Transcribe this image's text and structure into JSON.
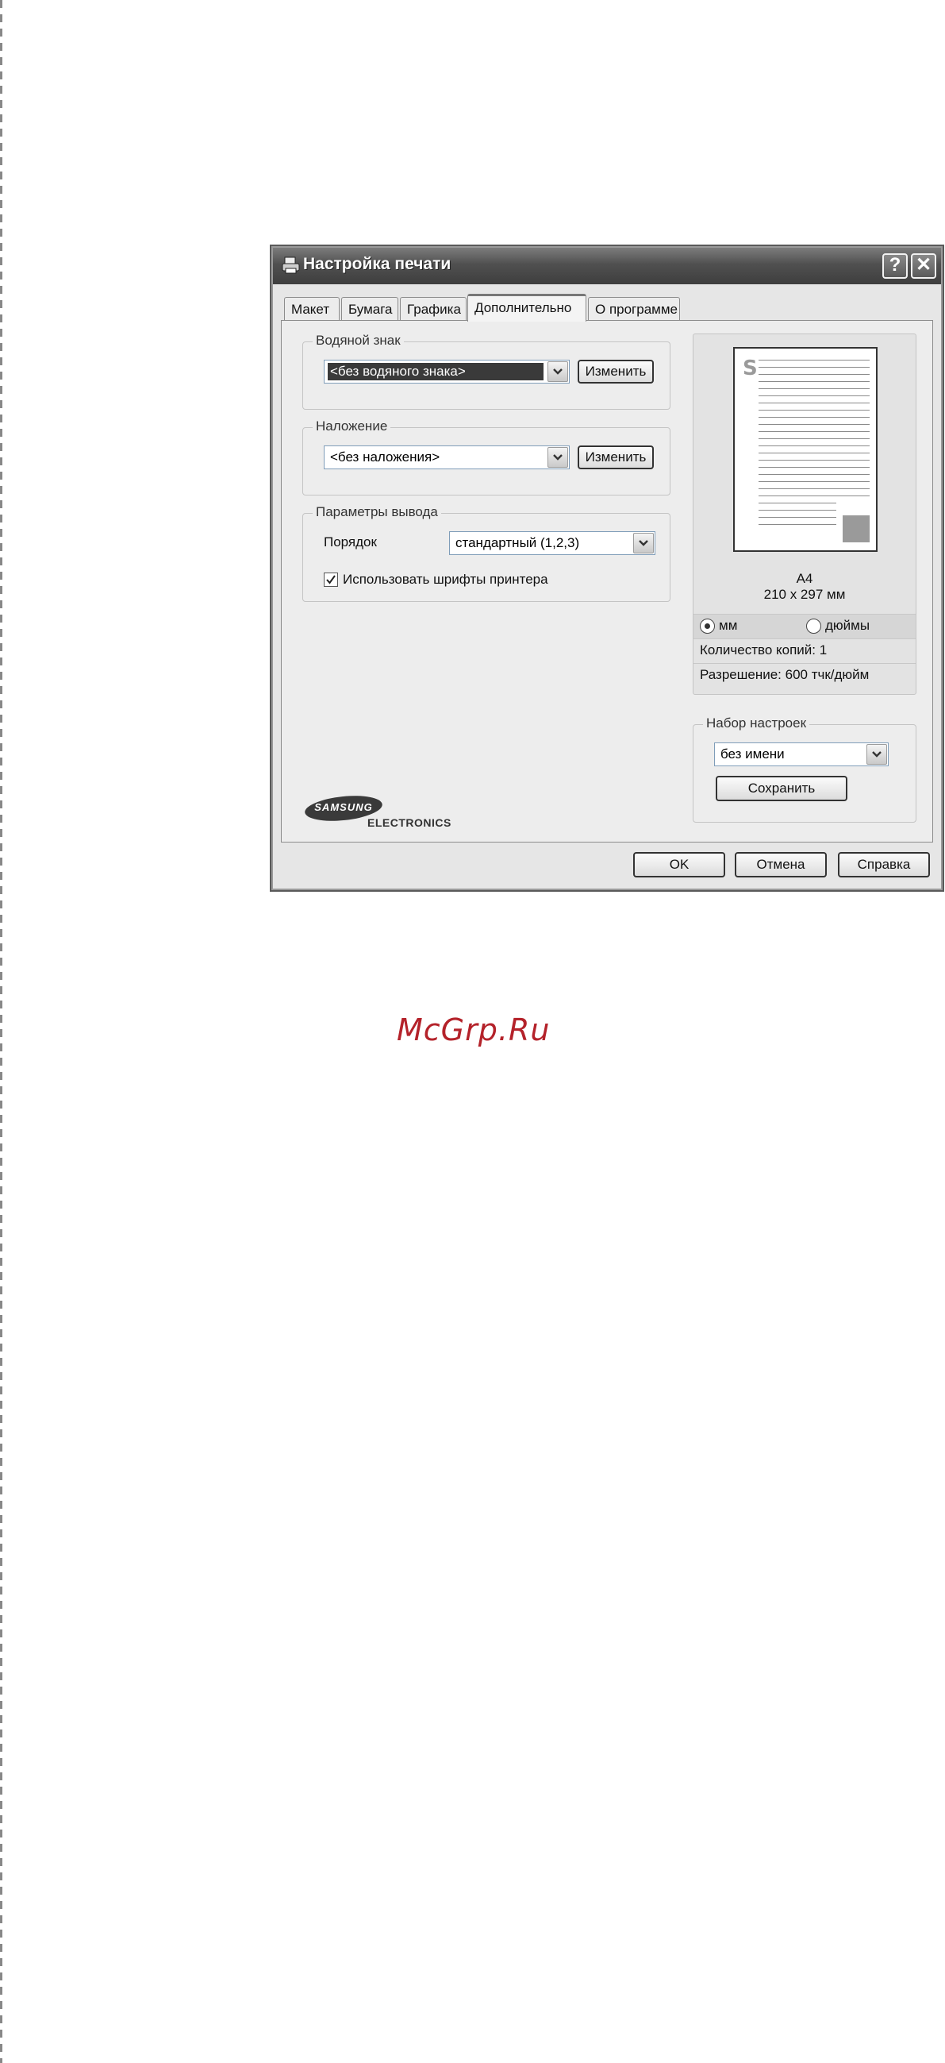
{
  "window": {
    "title": "Настройка печати",
    "help_button": "?",
    "close_button": "✕"
  },
  "tabs": [
    {
      "label": "Макет"
    },
    {
      "label": "Бумага"
    },
    {
      "label": "Графика"
    },
    {
      "label": "Дополнительно",
      "active": true
    },
    {
      "label": "О программе"
    }
  ],
  "watermark_group": {
    "legend": "Водяной знак",
    "selected": "<без водяного знака>",
    "edit_button": "Изменить"
  },
  "overlay_group": {
    "legend": "Наложение",
    "selected": "<без наложения>",
    "edit_button": "Изменить"
  },
  "output_group": {
    "legend": "Параметры вывода",
    "order_label": "Порядок",
    "order_value": "стандартный (1,2,3)",
    "printer_fonts_label": "Использовать шрифты принтера",
    "printer_fonts_checked": true
  },
  "preview": {
    "paper_name": "A4",
    "paper_size": "210 x 297 мм",
    "unit_mm": "мм",
    "unit_inches": "дюймы",
    "unit_selected": "мм",
    "copies": "Количество копий: 1",
    "resolution": "Разрешение: 600 тчк/дюйм"
  },
  "presets_group": {
    "legend": "Набор настроек",
    "selected": "без имени",
    "save_button": "Сохранить"
  },
  "logo": {
    "brand": "SAMSUNG",
    "sub": "ELECTRONICS"
  },
  "footer": {
    "ok_button": "OK",
    "cancel_button": "Отмена",
    "help_button": "Справка"
  },
  "page_watermark": "McGrp.Ru",
  "colors": {
    "titlebar": "#505050",
    "watermark_red": "#b4222a"
  }
}
